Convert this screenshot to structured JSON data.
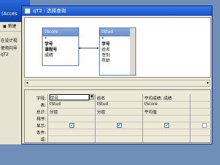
{
  "background_window": {
    "title": "(Acces",
    "toolbar_new": "新建",
    "items": [
      "在设计视",
      "使用向导",
      "qT2"
    ]
  },
  "query_window": {
    "title": "qT2 : 选择查询"
  },
  "tables": [
    {
      "name": "tScore",
      "fields": [
        "*",
        "学号",
        "课程号",
        "成绩"
      ],
      "bold": [
        false,
        true,
        true,
        false
      ]
    },
    {
      "name": "tStud",
      "fields": [
        "*",
        "学号",
        "姓名",
        "性别",
        "年龄"
      ],
      "bold": [
        false,
        true,
        false,
        false,
        false
      ]
    }
  ],
  "grid": {
    "row_labels": [
      "字段:",
      "表:",
      "总计:",
      "排序:",
      "显示:",
      "条件:",
      "或:"
    ],
    "columns": [
      {
        "field": "学号",
        "table": "tStud",
        "total": "分组",
        "show": true
      },
      {
        "field": "姓名",
        "table": "tStud",
        "total": "分组",
        "show": true
      },
      {
        "field": "平均成绩: 成绩",
        "table": "tScore",
        "total": "平均值",
        "show": true
      }
    ]
  }
}
